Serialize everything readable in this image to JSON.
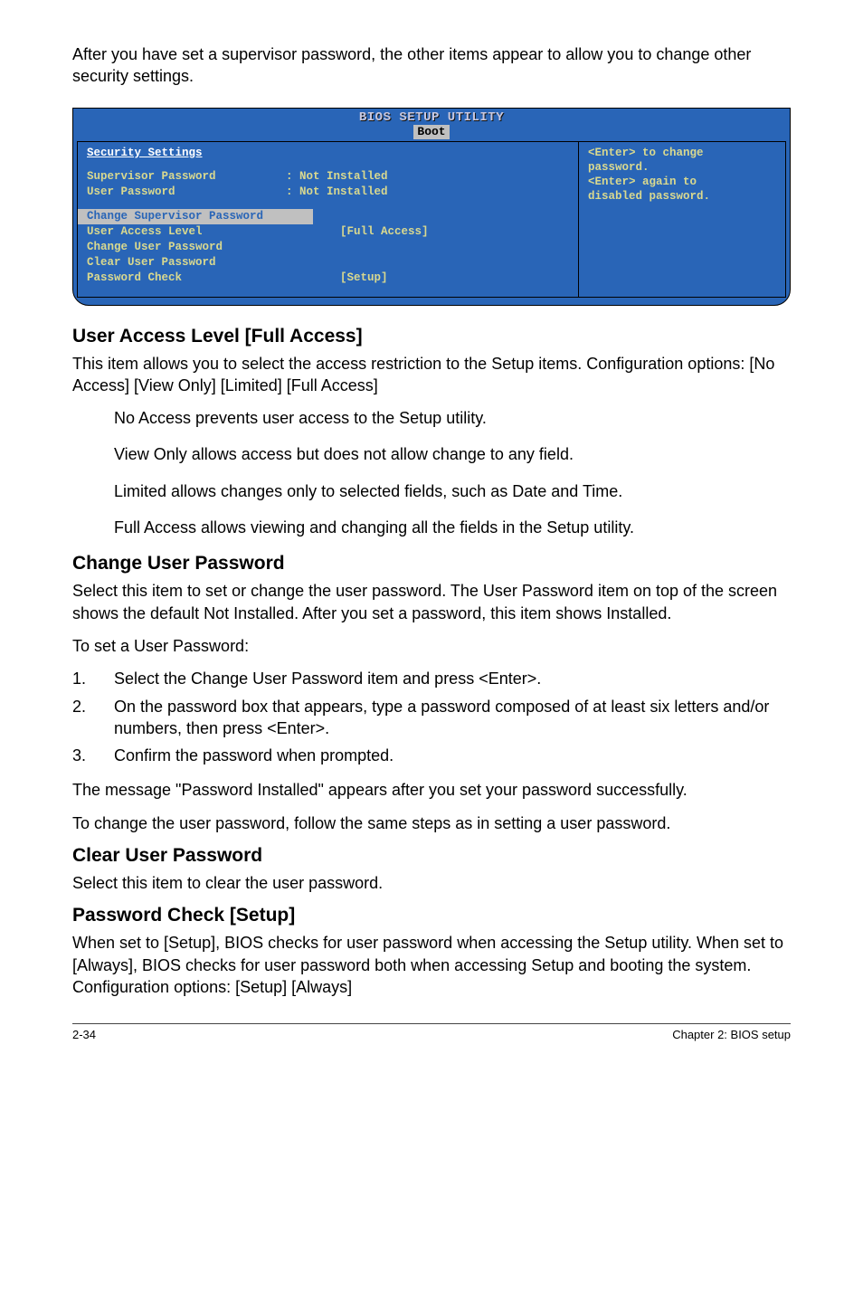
{
  "intro": "After you have set a supervisor password, the other items appear to allow you to change other security settings.",
  "bios": {
    "title": "BIOS SETUP UTILITY",
    "tab": "Boot",
    "sectionTitle": "Security Settings",
    "rows": {
      "supPwd_label": "Supervisor Password",
      "supPwd_value": ": Not Installed",
      "usrPwd_label": "User Password",
      "usrPwd_value": ": Not Installed",
      "changeSup": "Change Supervisor Password",
      "ual_label": "User Access Level",
      "ual_value": "[Full Access]",
      "changeUser": "Change User Password",
      "clearUser": "Clear User Password",
      "pwcheck_label": "Password Check",
      "pwcheck_value": "[Setup]"
    },
    "help": {
      "l1": "<Enter> to change",
      "l2": "password.",
      "l3": "<Enter> again to",
      "l4": "disabled password."
    }
  },
  "sections": {
    "ual": {
      "heading": "User Access Level [Full Access]",
      "p1": "This item allows you to select the access restriction to the Setup items. Configuration options: [No Access] [View Only] [Limited] [Full Access]",
      "noAccess": "No Access prevents user access to the Setup utility.",
      "viewOnly": "View Only allows access but does not allow change to any field.",
      "limited": "Limited allows changes only to selected fields, such as Date and Time.",
      "fullAccess": "Full Access allows viewing and changing all the fields in the Setup utility."
    },
    "cup": {
      "heading": "Change User Password",
      "p1": "Select this item to set or change the user password. The User Password item on top of the screen shows the default Not Installed. After you set a password, this item shows Installed.",
      "p2": "To set a User Password:",
      "li1": "Select the Change User Password item and press <Enter>.",
      "li2": "On the password box that appears, type a password composed of at least six letters and/or numbers, then press <Enter>.",
      "li3": "Confirm the password when prompted.",
      "p3": "The message \"Password Installed\" appears after you set your password successfully.",
      "p4": "To change the user password, follow the same steps as in setting a user password."
    },
    "clr": {
      "heading": "Clear User Password",
      "p1": "Select this item to clear the user password."
    },
    "pwc": {
      "heading": "Password Check [Setup]",
      "p1": "When set to [Setup], BIOS checks for user password when accessing the Setup utility. When set to [Always], BIOS checks for user password both when accessing Setup and booting the system. Configuration options: [Setup] [Always]"
    }
  },
  "footer": {
    "left": "2-34",
    "right": "Chapter 2: BIOS setup"
  }
}
